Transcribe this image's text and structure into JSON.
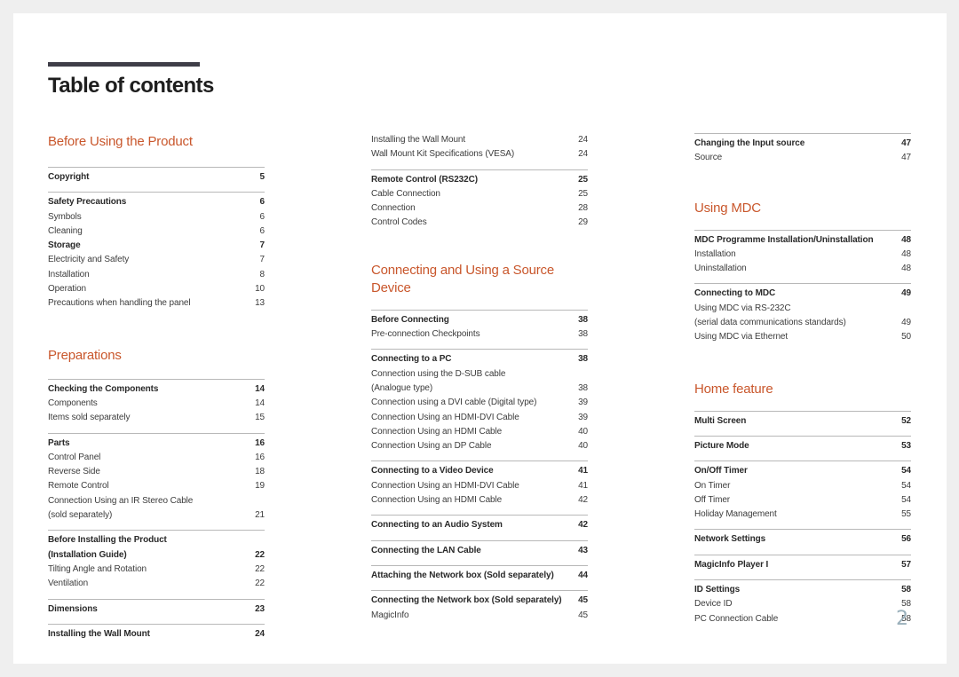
{
  "title": "Table of contents",
  "page_number": "2",
  "colors": {
    "accent": "#c9572c",
    "title_bar": "#3f3e48",
    "rule": "#b8b8b8",
    "page_bg": "#ffffff",
    "backdrop": "#efefef"
  },
  "columns": [
    {
      "blocks": [
        {
          "heading": "Before Using the Product",
          "groups": [
            {
              "rows": [
                {
                  "label": "Copyright",
                  "page": "5",
                  "bold": true
                }
              ]
            },
            {
              "rows": [
                {
                  "label": "Safety Precautions",
                  "page": "6",
                  "bold": true
                },
                {
                  "label": "Symbols",
                  "page": "6"
                },
                {
                  "label": "Cleaning",
                  "page": "6"
                },
                {
                  "label": "Storage",
                  "page": "7",
                  "bold": true
                },
                {
                  "label": "Electricity and Safety",
                  "page": "7"
                },
                {
                  "label": "Installation",
                  "page": "8"
                },
                {
                  "label": "Operation",
                  "page": "10"
                },
                {
                  "label": "Precautions when handling the panel",
                  "page": "13"
                }
              ]
            }
          ]
        },
        {
          "heading": "Preparations",
          "groups": [
            {
              "rows": [
                {
                  "label": "Checking the Components",
                  "page": "14",
                  "bold": true
                },
                {
                  "label": "Components",
                  "page": "14"
                },
                {
                  "label": "Items sold separately",
                  "page": "15"
                }
              ]
            },
            {
              "rows": [
                {
                  "label": "Parts",
                  "page": "16",
                  "bold": true
                },
                {
                  "label": "Control Panel",
                  "page": "16"
                },
                {
                  "label": "Reverse Side",
                  "page": "18"
                },
                {
                  "label": "Remote Control",
                  "page": "19"
                },
                {
                  "label": "Connection Using an IR Stereo Cable",
                  "page": ""
                },
                {
                  "label": "(sold separately)",
                  "page": "21"
                }
              ]
            },
            {
              "rows": [
                {
                  "label": "Before Installing the Product",
                  "page": "",
                  "bold": true
                },
                {
                  "label": "(Installation Guide)",
                  "page": "22",
                  "bold": true
                },
                {
                  "label": "Tilting Angle and Rotation",
                  "page": "22"
                },
                {
                  "label": "Ventilation",
                  "page": "22"
                }
              ]
            },
            {
              "rows": [
                {
                  "label": "Dimensions",
                  "page": "23",
                  "bold": true
                }
              ]
            },
            {
              "rows": [
                {
                  "label": "Installing the Wall Mount",
                  "page": "24",
                  "bold": true
                }
              ]
            }
          ]
        }
      ]
    },
    {
      "blocks": [
        {
          "heading": "",
          "groups": [
            {
              "no_rule": true,
              "rows": [
                {
                  "label": "Installing the Wall Mount",
                  "page": "24"
                },
                {
                  "label": "Wall Mount Kit Specifications (VESA)",
                  "page": "24"
                }
              ]
            },
            {
              "rows": [
                {
                  "label": "Remote Control (RS232C)",
                  "page": "25",
                  "bold": true
                },
                {
                  "label": "Cable Connection",
                  "page": "25"
                },
                {
                  "label": "Connection",
                  "page": "28"
                },
                {
                  "label": "Control Codes",
                  "page": "29"
                }
              ]
            }
          ]
        },
        {
          "heading": "Connecting and Using a Source Device",
          "groups": [
            {
              "rows": [
                {
                  "label": "Before Connecting",
                  "page": "38",
                  "bold": true
                },
                {
                  "label": "Pre-connection Checkpoints",
                  "page": "38"
                }
              ]
            },
            {
              "rows": [
                {
                  "label": "Connecting to a PC",
                  "page": "38",
                  "bold": true
                },
                {
                  "label": "Connection using the D-SUB cable",
                  "page": ""
                },
                {
                  "label": "(Analogue type)",
                  "page": "38"
                },
                {
                  "label": "Connection using a DVI cable (Digital type)",
                  "page": "39"
                },
                {
                  "label": "Connection Using an HDMI-DVI Cable",
                  "page": "39"
                },
                {
                  "label": "Connection Using an HDMI Cable",
                  "page": "40"
                },
                {
                  "label": "Connection Using an DP Cable",
                  "page": "40"
                }
              ]
            },
            {
              "rows": [
                {
                  "label": "Connecting to a Video Device",
                  "page": "41",
                  "bold": true
                },
                {
                  "label": "Connection Using an HDMI-DVI Cable",
                  "page": "41"
                },
                {
                  "label": "Connection Using an HDMI Cable",
                  "page": "42"
                }
              ]
            },
            {
              "rows": [
                {
                  "label": "Connecting to an Audio System",
                  "page": "42",
                  "bold": true
                }
              ]
            },
            {
              "rows": [
                {
                  "label": "Connecting the LAN Cable",
                  "page": "43",
                  "bold": true
                }
              ]
            },
            {
              "rows": [
                {
                  "label": "Attaching the Network box (Sold separately)",
                  "page": "44",
                  "bold": true
                }
              ]
            },
            {
              "rows": [
                {
                  "label": "Connecting the Network box (Sold separately)",
                  "page": "45",
                  "bold": true
                },
                {
                  "label": "MagicInfo",
                  "page": "45"
                }
              ]
            }
          ]
        }
      ]
    },
    {
      "blocks": [
        {
          "heading": "",
          "groups": [
            {
              "rows": [
                {
                  "label": "Changing the Input source",
                  "page": "47",
                  "bold": true
                },
                {
                  "label": "Source",
                  "page": "47"
                }
              ]
            }
          ]
        },
        {
          "heading": "Using MDC",
          "groups": [
            {
              "rows": [
                {
                  "label": "MDC Programme Installation/Uninstallation",
                  "page": "48",
                  "bold": true
                },
                {
                  "label": "Installation",
                  "page": "48"
                },
                {
                  "label": "Uninstallation",
                  "page": "48"
                }
              ]
            },
            {
              "rows": [
                {
                  "label": "Connecting to MDC",
                  "page": "49",
                  "bold": true
                },
                {
                  "label": "Using MDC via RS-232C",
                  "page": ""
                },
                {
                  "label": "(serial data communications standards)",
                  "page": "49"
                },
                {
                  "label": "Using MDC via Ethernet",
                  "page": "50"
                }
              ]
            }
          ]
        },
        {
          "heading": "Home feature",
          "groups": [
            {
              "rows": [
                {
                  "label": "Multi Screen",
                  "page": "52",
                  "bold": true
                }
              ]
            },
            {
              "rows": [
                {
                  "label": "Picture Mode",
                  "page": "53",
                  "bold": true
                }
              ]
            },
            {
              "rows": [
                {
                  "label": "On/Off Timer",
                  "page": "54",
                  "bold": true
                },
                {
                  "label": "On Timer",
                  "page": "54"
                },
                {
                  "label": "Off Timer",
                  "page": "54"
                },
                {
                  "label": "Holiday Management",
                  "page": "55"
                }
              ]
            },
            {
              "rows": [
                {
                  "label": "Network Settings",
                  "page": "56",
                  "bold": true
                }
              ]
            },
            {
              "rows": [
                {
                  "label": "MagicInfo Player I",
                  "page": "57",
                  "bold": true
                }
              ]
            },
            {
              "rows": [
                {
                  "label": "ID Settings",
                  "page": "58",
                  "bold": true
                },
                {
                  "label": "Device ID",
                  "page": "58"
                },
                {
                  "label": "PC Connection Cable",
                  "page": "58"
                }
              ]
            }
          ]
        }
      ]
    }
  ]
}
